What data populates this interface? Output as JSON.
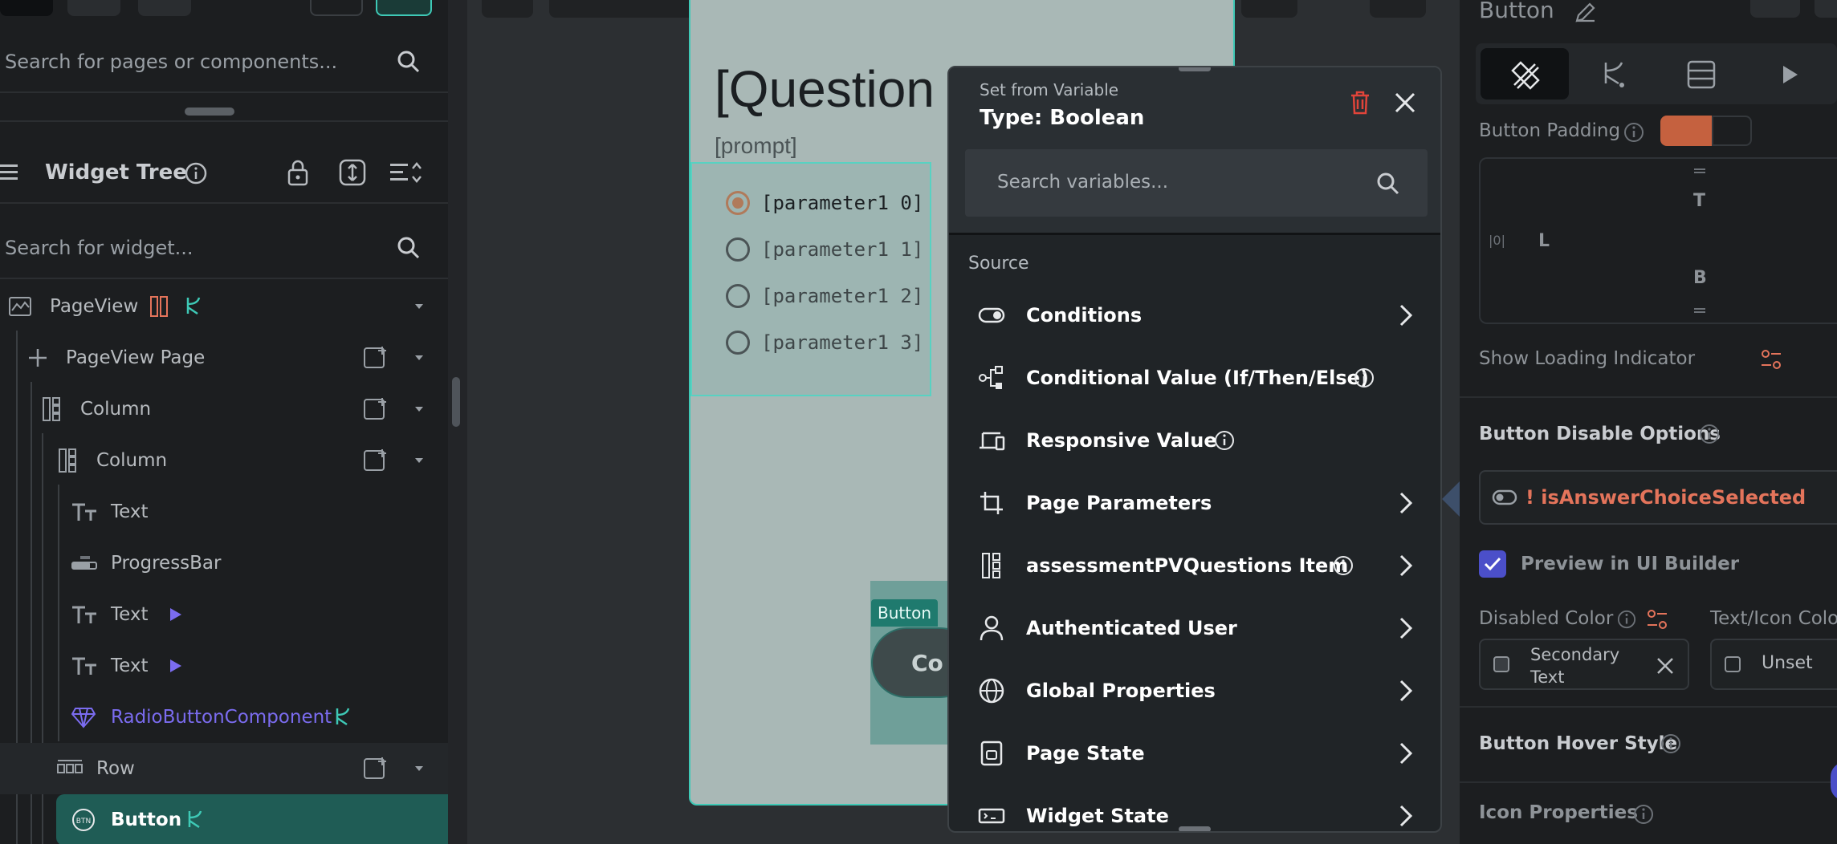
{
  "left_panel": {
    "page_search_placeholder": "Search for pages or components...",
    "widget_tree_title": "Widget Tree",
    "widget_search_placeholder": "Search for widget...",
    "tree": [
      {
        "label": "PageView"
      },
      {
        "label": "PageView Page"
      },
      {
        "label": "Column"
      },
      {
        "label": "Column"
      },
      {
        "label": "Text"
      },
      {
        "label": "ProgressBar"
      },
      {
        "label": "Text"
      },
      {
        "label": "Text"
      },
      {
        "label": "RadioButtonComponent"
      },
      {
        "label": "Row"
      },
      {
        "label": "Button"
      }
    ]
  },
  "canvas": {
    "question_title": "[Question",
    "prompt": "[prompt]",
    "options": [
      "[parameter1 0]",
      "[parameter1 1]",
      "[parameter1 2]",
      "[parameter1 3]"
    ],
    "button_tag": "Button",
    "button_text": "Co"
  },
  "popup": {
    "subtitle": "Set from Variable",
    "title": "Type: Boolean",
    "search_placeholder": "Search variables...",
    "section_label": "Source",
    "items": [
      {
        "label": "Conditions",
        "icon": "toggle-icon"
      },
      {
        "label": "Conditional Value (If/Then/Else)",
        "icon": "branch-icon"
      },
      {
        "label": "Responsive Value",
        "icon": "devices-icon"
      },
      {
        "label": "Page Parameters",
        "icon": "crop-icon"
      },
      {
        "label": "assessmentPVQuestions Item",
        "icon": "column-icon"
      },
      {
        "label": "Authenticated User",
        "icon": "user-icon"
      },
      {
        "label": "Global Properties",
        "icon": "globe-icon"
      },
      {
        "label": "Page State",
        "icon": "page-state-icon"
      },
      {
        "label": "Widget State",
        "icon": "widget-state-icon"
      }
    ]
  },
  "right_panel": {
    "title": "Button",
    "button_padding_label": "Button Padding",
    "pad_t": "T",
    "pad_l": "L",
    "pad_b": "B",
    "show_loading_label": "Show Loading Indicator",
    "disable_options_label": "Button Disable Options",
    "disable_variable": "! isAnswerChoiceSelected",
    "preview_label": "Preview in UI Builder",
    "disabled_color_label": "Disabled Color",
    "text_icon_color_label": "Text/Icon Colo",
    "disabled_color_value": "Secondary Text",
    "text_icon_color_value": "Unset",
    "hover_style_label": "Button Hover Style",
    "icon_properties_label": "Icon Properties"
  },
  "colors": {
    "accent_teal": "#3ec9b6",
    "selected_row": "#1f5c55",
    "danger": "#e4745b",
    "component_purple": "#7b6cf0",
    "checkbox": "#4b4fc9"
  }
}
